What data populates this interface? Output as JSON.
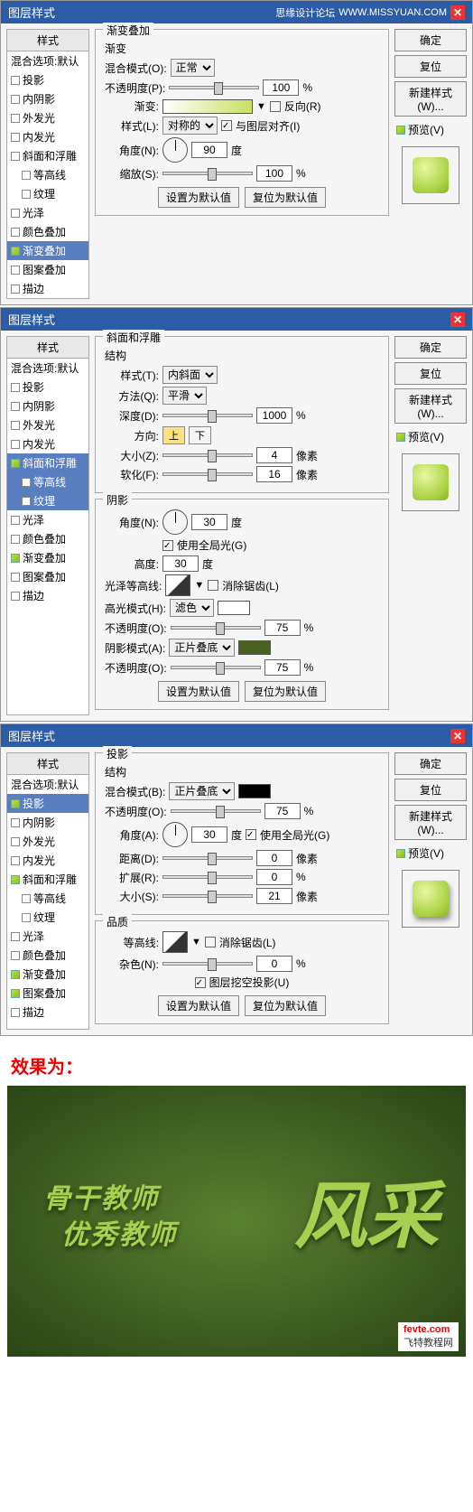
{
  "panels": [
    {
      "title": "图层样式",
      "brand": "思缘设计论坛",
      "url_txt": "WWW.MISSYUAN.COM",
      "sidebar": {
        "header": "样式",
        "blending": "混合选项:默认",
        "items": [
          {
            "label": "投影",
            "checked": false,
            "sel": false
          },
          {
            "label": "内阴影",
            "checked": false,
            "sel": false
          },
          {
            "label": "外发光",
            "checked": false,
            "sel": false
          },
          {
            "label": "内发光",
            "checked": false,
            "sel": false
          },
          {
            "label": "斜面和浮雕",
            "checked": false,
            "sel": false
          },
          {
            "label": "等高线",
            "checked": false,
            "sel": false,
            "sub": true
          },
          {
            "label": "纹理",
            "checked": false,
            "sel": false,
            "sub": true
          },
          {
            "label": "光泽",
            "checked": false,
            "sel": false
          },
          {
            "label": "颜色叠加",
            "checked": false,
            "sel": false
          },
          {
            "label": "渐变叠加",
            "checked": true,
            "sel": true
          },
          {
            "label": "图案叠加",
            "checked": false,
            "sel": false
          },
          {
            "label": "描边",
            "checked": false,
            "sel": false
          }
        ]
      },
      "main": {
        "group_title": "渐变叠加",
        "sub_title": "渐变",
        "blend_mode_lbl": "混合模式(O):",
        "blend_mode": "正常",
        "opacity_lbl": "不透明度(P):",
        "opacity": "100",
        "pct": "%",
        "gradient_lbl": "渐变:",
        "reverse_lbl": "反向(R)",
        "style_lbl": "样式(L):",
        "style": "对称的",
        "align_lbl": "与图层对齐(I)",
        "angle_lbl": "角度(N):",
        "angle": "90",
        "deg": "度",
        "scale_lbl": "缩放(S):",
        "scale": "100",
        "btn_default": "设置为默认值",
        "btn_reset": "复位为默认值"
      },
      "right": {
        "ok": "确定",
        "cancel": "复位",
        "new_style": "新建样式(W)...",
        "preview": "预览(V)"
      }
    },
    {
      "title": "图层样式",
      "sidebar": {
        "header": "样式",
        "blending": "混合选项:默认",
        "items": [
          {
            "label": "投影",
            "checked": false,
            "sel": false
          },
          {
            "label": "内阴影",
            "checked": false,
            "sel": false
          },
          {
            "label": "外发光",
            "checked": false,
            "sel": false
          },
          {
            "label": "内发光",
            "checked": false,
            "sel": false
          },
          {
            "label": "斜面和浮雕",
            "checked": true,
            "sel": true
          },
          {
            "label": "等高线",
            "checked": false,
            "sel": true,
            "sub": true
          },
          {
            "label": "纹理",
            "checked": false,
            "sel": true,
            "sub": true
          },
          {
            "label": "光泽",
            "checked": false,
            "sel": false
          },
          {
            "label": "颜色叠加",
            "checked": false,
            "sel": false
          },
          {
            "label": "渐变叠加",
            "checked": true,
            "sel": false
          },
          {
            "label": "图案叠加",
            "checked": false,
            "sel": false
          },
          {
            "label": "描边",
            "checked": false,
            "sel": false
          }
        ]
      },
      "main": {
        "group_title": "斜面和浮雕",
        "struct_title": "结构",
        "style_lbl": "样式(T):",
        "style": "内斜面",
        "technique_lbl": "方法(Q):",
        "technique": "平滑",
        "depth_lbl": "深度(D):",
        "depth": "1000",
        "pct": "%",
        "direction_lbl": "方向:",
        "up": "上",
        "down": "下",
        "size_lbl": "大小(Z):",
        "size": "4",
        "px": "像素",
        "soften_lbl": "软化(F):",
        "soften": "16",
        "shadow_title": "阴影",
        "angle_lbl": "角度(N):",
        "angle": "30",
        "deg": "度",
        "global_lbl": "使用全局光(G)",
        "alt_lbl": "高度:",
        "alt": "30",
        "gloss_lbl": "光泽等高线:",
        "anti_lbl": "消除锯齿(L)",
        "hl_mode_lbl": "高光模式(H):",
        "hl_mode": "滤色",
        "opacity_lbl": "不透明度(O):",
        "hl_opacity": "75",
        "sh_mode_lbl": "阴影模式(A):",
        "sh_mode": "正片叠底",
        "sh_opacity": "75",
        "btn_default": "设置为默认值",
        "btn_reset": "复位为默认值"
      },
      "right": {
        "ok": "确定",
        "cancel": "复位",
        "new_style": "新建样式(W)...",
        "preview": "预览(V)"
      }
    },
    {
      "title": "图层样式",
      "sidebar": {
        "header": "样式",
        "blending": "混合选项:默认",
        "items": [
          {
            "label": "投影",
            "checked": true,
            "sel": true
          },
          {
            "label": "内阴影",
            "checked": false,
            "sel": false
          },
          {
            "label": "外发光",
            "checked": false,
            "sel": false
          },
          {
            "label": "内发光",
            "checked": false,
            "sel": false
          },
          {
            "label": "斜面和浮雕",
            "checked": true,
            "sel": false
          },
          {
            "label": "等高线",
            "checked": false,
            "sel": false,
            "sub": true
          },
          {
            "label": "纹理",
            "checked": false,
            "sel": false,
            "sub": true
          },
          {
            "label": "光泽",
            "checked": false,
            "sel": false
          },
          {
            "label": "颜色叠加",
            "checked": false,
            "sel": false
          },
          {
            "label": "渐变叠加",
            "checked": true,
            "sel": false
          },
          {
            "label": "图案叠加",
            "checked": true,
            "sel": false
          },
          {
            "label": "描边",
            "checked": false,
            "sel": false
          }
        ]
      },
      "main": {
        "group_title": "投影",
        "struct_title": "结构",
        "blend_mode_lbl": "混合模式(B):",
        "blend_mode": "正片叠底",
        "opacity_lbl": "不透明度(O):",
        "opacity": "75",
        "pct": "%",
        "angle_lbl": "角度(A):",
        "angle": "30",
        "deg": "度",
        "global_lbl": "使用全局光(G)",
        "distance_lbl": "距离(D):",
        "distance": "0",
        "px": "像素",
        "spread_lbl": "扩展(R):",
        "spread": "0",
        "size_lbl": "大小(S):",
        "size": "21",
        "quality_title": "品质",
        "contour_lbl": "等高线:",
        "anti_lbl": "消除锯齿(L)",
        "noise_lbl": "杂色(N):",
        "noise": "0",
        "knockout_lbl": "图层挖空投影(U)",
        "btn_default": "设置为默认值",
        "btn_reset": "复位为默认值"
      },
      "right": {
        "ok": "确定",
        "cancel": "复位",
        "new_style": "新建样式(W)...",
        "preview": "预览(V)"
      }
    }
  ],
  "result_label": "效果为：",
  "result_text1": "骨干教师",
  "result_text2": "优秀教师",
  "result_text3": "风采",
  "watermark_a": "fevte.com",
  "watermark_b": "飞特教程网"
}
